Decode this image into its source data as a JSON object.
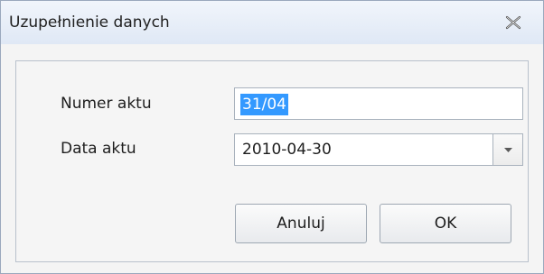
{
  "dialog": {
    "title": "Uzupełnienie danych",
    "close_icon": "close-icon"
  },
  "form": {
    "numer_label": "Numer aktu",
    "numer_value": "31/04",
    "data_label": "Data aktu",
    "data_value": "2010-04-30",
    "dropdown_icon": "chevron-down-icon"
  },
  "buttons": {
    "cancel_label": "Anuluj",
    "ok_label": "OK"
  },
  "colors": {
    "selection": "#3399ff",
    "titlebar_bottom": "#dfe8f5",
    "border": "#9aa8bd"
  }
}
